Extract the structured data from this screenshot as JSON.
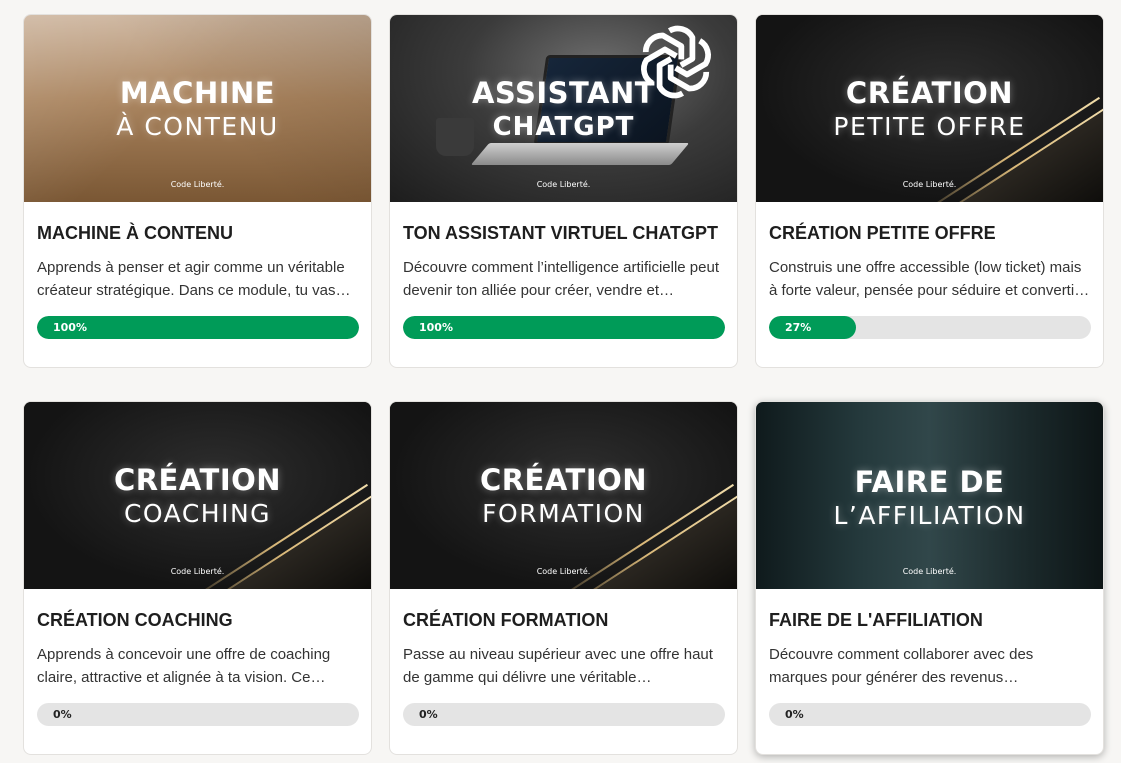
{
  "colors": {
    "progress_fill": "#009b58",
    "progress_track": "#e4e4e4",
    "card_bg": "#ffffff"
  },
  "courses": [
    {
      "thumb_style": "gold",
      "thumb_line1": "MACHINE",
      "thumb_line2": "À CONTENU",
      "brand": "Code Liberté.",
      "title": "MACHINE À CONTENU",
      "description": "Apprends à penser et agir comme un véritable créateur stratégique. Dans ce module, tu vas découvrir comment créer du contenu qui attire, engage et convertit.",
      "progress": 100,
      "progress_label": "100%"
    },
    {
      "thumb_style": "desk",
      "thumb_line1": "ASSISTANT",
      "thumb_line2": "CHATGPT",
      "brand": "Code Liberté.",
      "icon": "chatgpt-logo-icon",
      "title": "TON ASSISTANT VIRTUEL CHATGPT",
      "description": "Découvre comment l’intelligence artificielle peut devenir ton alliée pour créer, vendre et automatiser ton business.",
      "progress": 100,
      "progress_label": "100%"
    },
    {
      "thumb_style": "dark",
      "thumb_line1": "CRÉATION",
      "thumb_line2": "PETITE OFFRE",
      "brand": "Code Liberté.",
      "title": "CRÉATION PETITE OFFRE",
      "description": "Construis une offre accessible (low ticket) mais à forte valeur, pensée pour séduire et convertir tes premiers clients.",
      "progress": 27,
      "progress_label": "27%"
    },
    {
      "thumb_style": "dark",
      "thumb_line1": "CRÉATION",
      "thumb_line2": "COACHING",
      "brand": "Code Liberté.",
      "title": "CRÉATION COACHING",
      "description": "Apprends à concevoir une offre de coaching claire, attractive et alignée à ta vision. Ce module t’accompagne pas à pas.",
      "progress": 0,
      "progress_label": "0%"
    },
    {
      "thumb_style": "dark",
      "thumb_line1": "CRÉATION",
      "thumb_line2": "FORMATION",
      "brand": "Code Liberté.",
      "title": "CRÉATION FORMATION",
      "description": "Passe au niveau supérieur avec une offre haut de gamme qui délivre une véritable transformation à tes clients.",
      "progress": 0,
      "progress_label": "0%"
    },
    {
      "thumb_style": "hands",
      "thumb_line1": "FAIRE DE",
      "thumb_line2": "L’AFFILIATION",
      "brand": "Code Liberté.",
      "title": "FAIRE DE L'AFFILIATION",
      "description": "Découvre comment collaborer avec des marques pour générer des revenus complémentaires grâce à l’affiliation.",
      "progress": 0,
      "progress_label": "0%"
    }
  ]
}
